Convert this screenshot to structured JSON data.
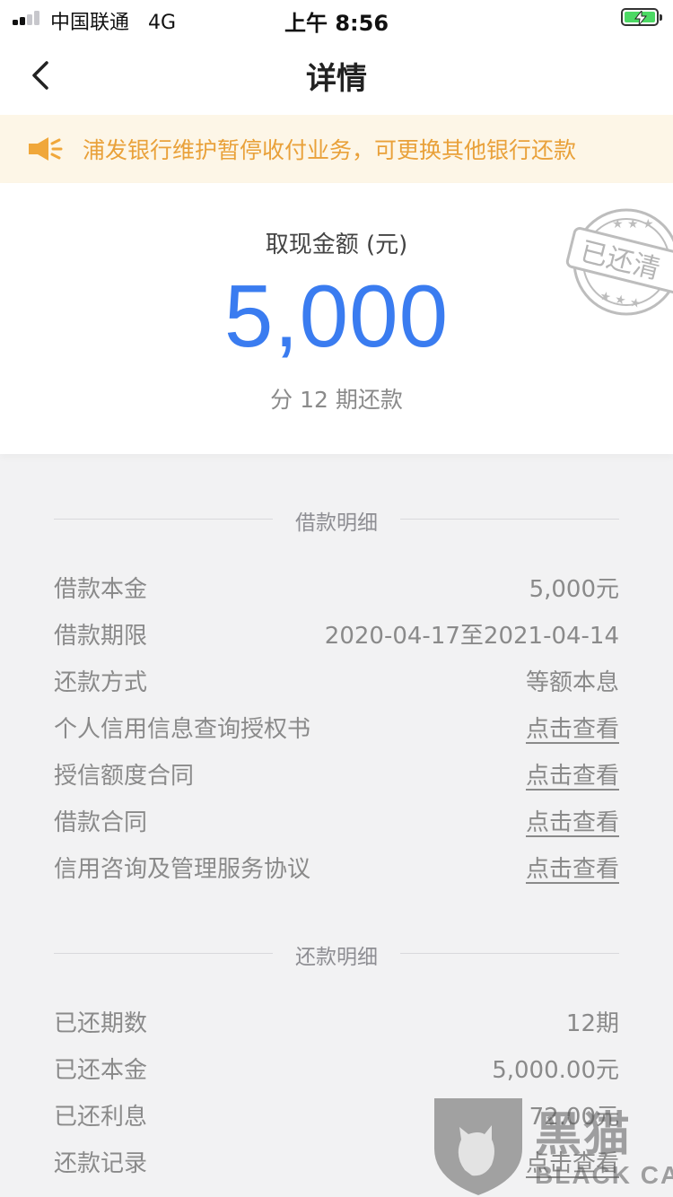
{
  "status_bar": {
    "carrier": "中国联通",
    "network": "4G",
    "time": "上午 8:56"
  },
  "nav": {
    "title": "详情",
    "back_icon": "chevron-left-icon"
  },
  "notice": {
    "icon": "speaker-icon",
    "text": "浦发银行维护暂停收付业务，可更换其他银行还款",
    "color": "#e9a13a"
  },
  "summary": {
    "label": "取现金额 (元)",
    "amount": "5,000",
    "installments": "分 12 期还款",
    "stamp_text": "已还清",
    "amount_color": "#3a7cf0"
  },
  "loan_details": {
    "title": "借款明细",
    "rows": [
      {
        "label": "借款本金",
        "value": "5,000元"
      },
      {
        "label": "借款期限",
        "value": "2020-04-17至2021-04-14"
      },
      {
        "label": "还款方式",
        "value": "等额本息"
      },
      {
        "label": "个人信用信息查询授权书",
        "value": "点击查看"
      },
      {
        "label": "授信额度合同",
        "value": "点击查看"
      },
      {
        "label": "借款合同",
        "value": "点击查看"
      },
      {
        "label": "信用咨询及管理服务协议",
        "value": "点击查看"
      }
    ]
  },
  "repay_details": {
    "title": "还款明细",
    "rows": [
      {
        "label": "已还期数",
        "value": "12期"
      },
      {
        "label": "已还本金",
        "value": "5,000.00元"
      },
      {
        "label": "已还利息",
        "value": "72.00元"
      },
      {
        "label": "还款记录",
        "value": "点击查看"
      }
    ]
  },
  "watermark": {
    "cn": "黑猫",
    "en": "BLACK CAT"
  }
}
